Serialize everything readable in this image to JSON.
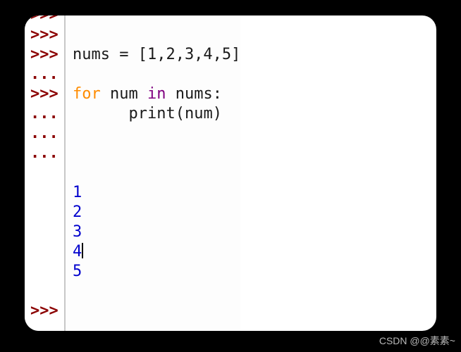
{
  "prompts": {
    "primary": ">>>",
    "continuation": "..."
  },
  "code": {
    "line1": "nums = [1,2,3,4,5]",
    "line2_for": "for",
    "line2_var": " num ",
    "line2_in": "in",
    "line2_iter": " nums:",
    "line3_indent": "      ",
    "line3_func": "print",
    "line3_open": "(",
    "line3_arg": "num",
    "line3_close": ")"
  },
  "output": {
    "v1": "1",
    "v2": "2",
    "v3": "3",
    "v4": "4",
    "v5": "5"
  },
  "watermark": "CSDN @@素素~"
}
